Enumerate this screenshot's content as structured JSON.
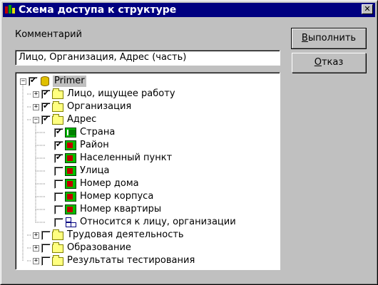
{
  "window": {
    "title": "Схема доступа к структуре",
    "close_glyph": "✕"
  },
  "comment": {
    "label": "Комментарий",
    "value": "Лицо, Организация,  Адрес (часть)"
  },
  "buttons": {
    "run": {
      "pre": "",
      "mnemonic": "В",
      "post": "ыполнить"
    },
    "cancel": {
      "pre": "",
      "mnemonic": "О",
      "post": "тказ"
    }
  },
  "tree": {
    "root": {
      "label": "Primer",
      "checked": true,
      "expanded": true,
      "icon": "database-icon"
    },
    "items": [
      {
        "label": "Лицо, ищущее работу",
        "checked": true,
        "expander": "+",
        "icon": "folder-icon",
        "level": 1
      },
      {
        "label": "Организация",
        "checked": true,
        "expander": "+",
        "icon": "folder-icon",
        "level": 1
      },
      {
        "label": "Адрес",
        "checked": true,
        "expander": "−",
        "icon": "folder-icon",
        "level": 1
      },
      {
        "label": "Страна",
        "checked": true,
        "expander": "",
        "icon": "key-field-icon",
        "level": 2
      },
      {
        "label": "Район",
        "checked": true,
        "expander": "",
        "icon": "field-icon",
        "level": 2
      },
      {
        "label": "Населенный пункт",
        "checked": true,
        "expander": "",
        "icon": "field-icon",
        "level": 2
      },
      {
        "label": "Улица",
        "checked": false,
        "expander": "",
        "icon": "field-icon",
        "level": 2
      },
      {
        "label": "Номер дома",
        "checked": false,
        "expander": "",
        "icon": "field-icon",
        "level": 2
      },
      {
        "label": "Номер корпуса",
        "checked": false,
        "expander": "",
        "icon": "field-icon",
        "level": 2
      },
      {
        "label": "Номер квартиры",
        "checked": false,
        "expander": "",
        "icon": "field-icon",
        "level": 2
      },
      {
        "label": "Относится к лицу, организации",
        "checked": false,
        "expander": "",
        "icon": "relation-icon",
        "level": 2
      },
      {
        "label": "Трудовая деятельность",
        "checked": false,
        "expander": "+",
        "icon": "folder-icon",
        "level": 1
      },
      {
        "label": "Образование",
        "checked": false,
        "expander": "+",
        "icon": "folder-icon",
        "level": 1
      },
      {
        "label": "Результаты тестирования",
        "checked": false,
        "expander": "+",
        "icon": "folder-icon",
        "level": 1
      }
    ]
  },
  "colors": {
    "titlebar": "#000080",
    "face": "#c0c0c0",
    "folder": "#ffff80",
    "field": "#00c000"
  }
}
